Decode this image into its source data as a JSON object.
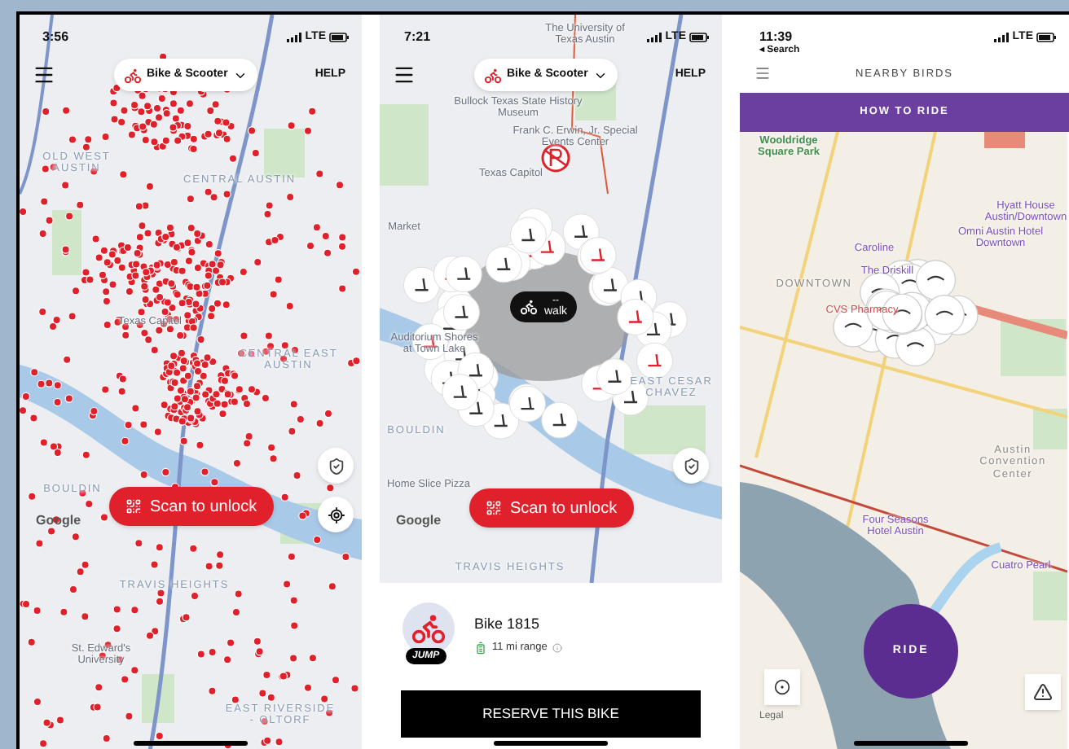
{
  "screen_1": {
    "status": {
      "time": "3:56",
      "network": "LTE"
    },
    "header": {
      "mode": "Bike & Scooter",
      "help": "HELP"
    },
    "map_labels": [
      {
        "text": "OLD WEST AUSTIN",
        "kind": "district"
      },
      {
        "text": "CENTRAL AUSTIN",
        "kind": "district"
      },
      {
        "text": "Texas Capitol",
        "kind": "place"
      },
      {
        "text": "CENTRAL EAST AUSTIN",
        "kind": "district"
      },
      {
        "text": "BOULDIN",
        "kind": "district"
      },
      {
        "text": "TRAVIS HEIGHTS",
        "kind": "district"
      },
      {
        "text": "St. Edward's University",
        "kind": "place"
      },
      {
        "text": "EAST RIVERSIDE - OLTORF",
        "kind": "district"
      }
    ],
    "attribution": "Google",
    "scan_button": "Scan to unlock"
  },
  "screen_2": {
    "status": {
      "time": "7:21",
      "network": "LTE"
    },
    "header": {
      "mode": "Bike & Scooter",
      "help": "HELP"
    },
    "map_labels": [
      {
        "text": "The University of Texas Austin",
        "kind": "place"
      },
      {
        "text": "Bullock Texas State History Museum",
        "kind": "place"
      },
      {
        "text": "Frank C. Erwin, Jr. Special Events Center",
        "kind": "place"
      },
      {
        "text": "Texas Capitol",
        "kind": "place"
      },
      {
        "text": "Market",
        "kind": "place"
      },
      {
        "text": "Auditorium Shores at Town Lake",
        "kind": "place"
      },
      {
        "text": "EAST CESAR CHAVEZ",
        "kind": "district"
      },
      {
        "text": "BOULDIN",
        "kind": "district"
      },
      {
        "text": "Home Slice Pizza",
        "kind": "place"
      },
      {
        "text": "TRAVIS HEIGHTS",
        "kind": "district"
      }
    ],
    "walk_bubble": {
      "time": "--",
      "label": "walk"
    },
    "attribution": "Google",
    "scan_button": "Scan to unlock",
    "vehicle": {
      "brand": "JUMP",
      "name": "Bike 1815",
      "range": "11 mi range"
    },
    "reserve_button": "RESERVE THIS BIKE"
  },
  "screen_3": {
    "status": {
      "time": "11:39",
      "back": "◂ Search",
      "network": "LTE"
    },
    "title": "NEARBY BIRDS",
    "banner": "HOW TO RIDE",
    "map_labels": [
      {
        "text": "Wooldridge Square Park",
        "kind": "park"
      },
      {
        "text": "Hyatt House Austin/Downtown",
        "kind": "place"
      },
      {
        "text": "Omni Austin Hotel Downtown",
        "kind": "place"
      },
      {
        "text": "Caroline",
        "kind": "place"
      },
      {
        "text": "The Driskill",
        "kind": "place"
      },
      {
        "text": "DOWNTOWN",
        "kind": "district"
      },
      {
        "text": "CVS Pharmacy",
        "kind": "shop"
      },
      {
        "text": "Austin Convention Center",
        "kind": "district"
      },
      {
        "text": "Four Seasons Hotel Austin",
        "kind": "place"
      },
      {
        "text": "Cuatro Pearl",
        "kind": "place"
      }
    ],
    "ride_button": "RIDE",
    "legal": "Legal"
  }
}
